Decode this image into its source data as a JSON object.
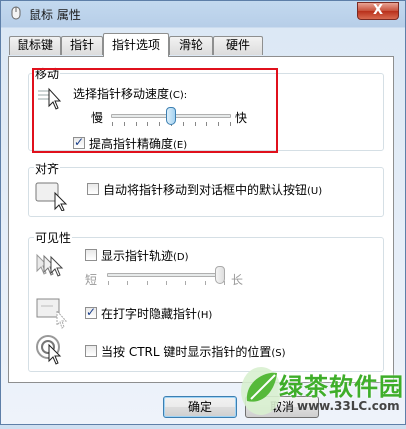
{
  "window": {
    "title": "鼠标 属性",
    "close_label": "X"
  },
  "tabs": [
    {
      "label": "鼠标键"
    },
    {
      "label": "指针"
    },
    {
      "label": "指针选项"
    },
    {
      "label": "滑轮"
    },
    {
      "label": "硬件"
    }
  ],
  "motion": {
    "group_label": "移动",
    "speed_label": "选择指针移动速度",
    "speed_hotkey": "(C):",
    "slow_label": "慢",
    "fast_label": "快",
    "speed_value": 0.5,
    "precision_label": "提高指针精确度",
    "precision_hotkey": "(E)",
    "precision_checked": true
  },
  "snap_to": {
    "group_label": "对齐",
    "label": "自动将指针移动到对话框中的默认按钮",
    "hotkey": "(U)",
    "checked": false
  },
  "visibility": {
    "group_label": "可见性",
    "trails_label": "显示指针轨迹",
    "trails_hotkey": "(D)",
    "trails_checked": false,
    "short_label": "短",
    "long_label": "长",
    "trail_length_value": 1.0,
    "hide_label": "在打字时隐藏指针",
    "hide_hotkey": "(H)",
    "hide_checked": true,
    "ctrl_label": "当按 CTRL 键时显示指针的位置",
    "ctrl_hotkey": "(S)",
    "ctrl_checked": false
  },
  "buttons": {
    "ok": "确定",
    "cancel": "取消"
  },
  "watermark": {
    "brand": "绿茶软件园",
    "url": "www.33LC.com"
  },
  "colors": {
    "highlight": "#e0101c",
    "watermark_green": "#3fae2a"
  }
}
